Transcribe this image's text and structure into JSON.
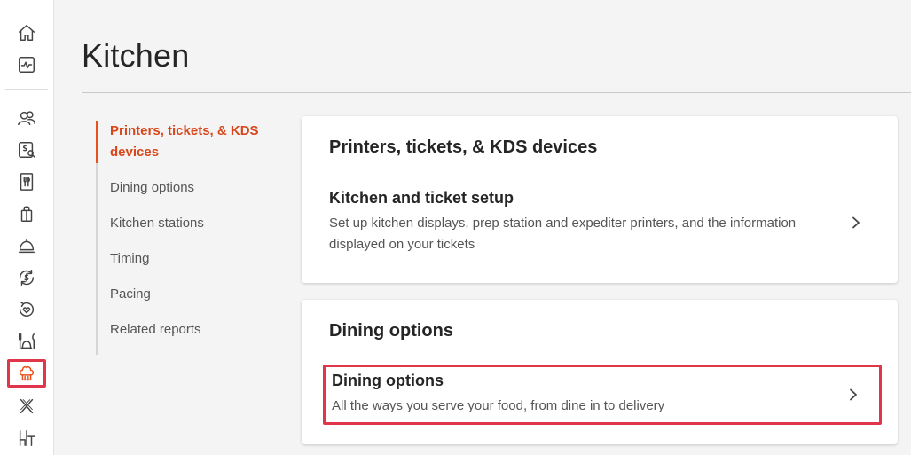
{
  "rail": {
    "icons": [
      "home-icon",
      "activity-icon",
      "guests-icon",
      "payroll-icon",
      "menu-icon",
      "shopping-bag-icon",
      "service-bell-icon",
      "dollar-refresh-icon",
      "loyalty-icon",
      "dining-icon",
      "chef-hat-icon",
      "x-icon",
      "tables-icon"
    ]
  },
  "page": {
    "title": "Kitchen"
  },
  "subnav": {
    "items": [
      "Printers, tickets, & KDS devices",
      "Dining options",
      "Kitchen stations",
      "Timing",
      "Pacing",
      "Related reports"
    ]
  },
  "cards": {
    "printers": {
      "heading": "Printers, tickets, & KDS devices",
      "row_title": "Kitchen and ticket setup",
      "row_desc": "Set up kitchen displays, prep station and expediter printers, and the information displayed on your tickets"
    },
    "dining": {
      "heading": "Dining options",
      "row_title": "Dining options",
      "row_desc": "All the ways you serve your food, from dine in to delivery"
    }
  },
  "colors": {
    "accent": "#e8501c",
    "highlight": "#e0364a"
  }
}
